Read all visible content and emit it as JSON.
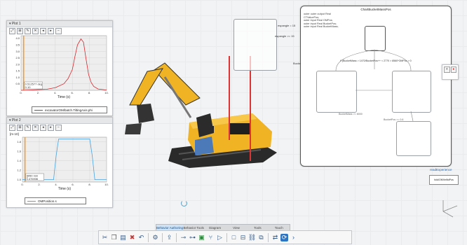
{
  "scene": {
    "plot1": {
      "title": "Plot 1",
      "y_ticks": [
        "4.0",
        "3.5",
        "3.0",
        "2.5",
        "2.0",
        "1.5",
        "1.0",
        "0.5"
      ],
      "x_ticks": [
        "0.",
        "2.",
        "4.",
        "6.",
        "8.",
        "10."
      ],
      "x_label": "Time (s)",
      "cursor_labels": [
        "0.512577 deg",
        "0.10"
      ],
      "legend": "excavatorOM/batch.TiltingAxis.phi",
      "line_color": "#d9252b",
      "cursor_color": "#f39c33"
    },
    "plot2": {
      "title": "Plot 2",
      "unit": "[m·10]",
      "y_ticks": [
        "1.8",
        "1.6",
        "1.4",
        "1.2",
        "1.0"
      ],
      "x_ticks": [
        "0.",
        "2.",
        "4.",
        "6.",
        "8.",
        "10."
      ],
      "x_label": "Time (s)",
      "cursor_labels": [
        "[]050 mm",
        "0.476936"
      ],
      "legend": "OMPosition.s",
      "line_color": "#4aa3df",
      "cursor_color": "#f39c33"
    },
    "signal_labels": {
      "empangle_top": "espangle = 15",
      "empangle_mid": "espangle >= 15",
      "bucket_mass": "BucketMass >= 10000"
    },
    "state_chart": {
      "title": "ChartBucketMassPos",
      "code_lines": [
        "outer outer output Real CTValuePos;",
        "outer input Real OMPos;",
        "outer input Real BucketPos;",
        "outer input Real BucketMass;"
      ],
      "condition": "if (BucketMass > 1470/BucketPos++ < 2770 > 8560*OMPos > 0",
      "transition_a": "BucketMass >= 8000",
      "transition_b": "BucketPos >= 0.6"
    },
    "right_label": "readExperience",
    "right_block": "fold/OMVelfidPos"
  },
  "ribbon": {
    "tabs": [
      "Behavior Authoring",
      "Behavior Tools",
      "Diagram",
      "View",
      "Tools",
      "Touch"
    ],
    "active_index": 0
  },
  "toolbar": {
    "icons": [
      "scissors-icon",
      "copy-icon",
      "paste-icon",
      "delete-icon",
      "undo-icon",
      "redo-icon",
      "settings-icon",
      "share-icon",
      "connect-icon",
      "split-icon",
      "record-icon",
      "branch-icon",
      "play-icon",
      "stop-icon",
      "rewind-icon",
      "chain-icon",
      "layers-icon",
      "sync-icon",
      "refresh-icon",
      "next-icon"
    ]
  },
  "chart_data": [
    {
      "type": "line",
      "title": "Plot 1",
      "xlabel": "Time (s)",
      "ylabel": "",
      "xlim": [
        0,
        10
      ],
      "ylim": [
        0,
        4.2
      ],
      "series": [
        {
          "name": "excavatorOM/batch.TiltingAxis.phi",
          "x": [
            0,
            1,
            2,
            3,
            4,
            5,
            5.5,
            6,
            6.3,
            6.6,
            7,
            7.3,
            7.6,
            7.9,
            8.2,
            8.5,
            9,
            10
          ],
          "y": [
            0,
            0.02,
            0.05,
            0.08,
            0.2,
            0.5,
            0.9,
            1.6,
            2.6,
            3.5,
            3.95,
            3.7,
            2.4,
            1.2,
            0.6,
            0.3,
            0.1,
            0.02
          ]
        }
      ]
    },
    {
      "type": "line",
      "title": "Plot 2",
      "xlabel": "Time (s)",
      "ylabel": "[m·10]",
      "xlim": [
        0,
        10
      ],
      "ylim": [
        0.95,
        1.9
      ],
      "series": [
        {
          "name": "OMPosition.s",
          "x": [
            0,
            1,
            2,
            3,
            3.7,
            4.0,
            4.3,
            6,
            7.5,
            8.0,
            8.3,
            8.6,
            10
          ],
          "y": [
            1.0,
            1.0,
            1.0,
            1.0,
            1.0,
            1.5,
            1.86,
            1.86,
            1.86,
            1.86,
            1.5,
            1.0,
            1.0
          ]
        }
      ]
    }
  ]
}
